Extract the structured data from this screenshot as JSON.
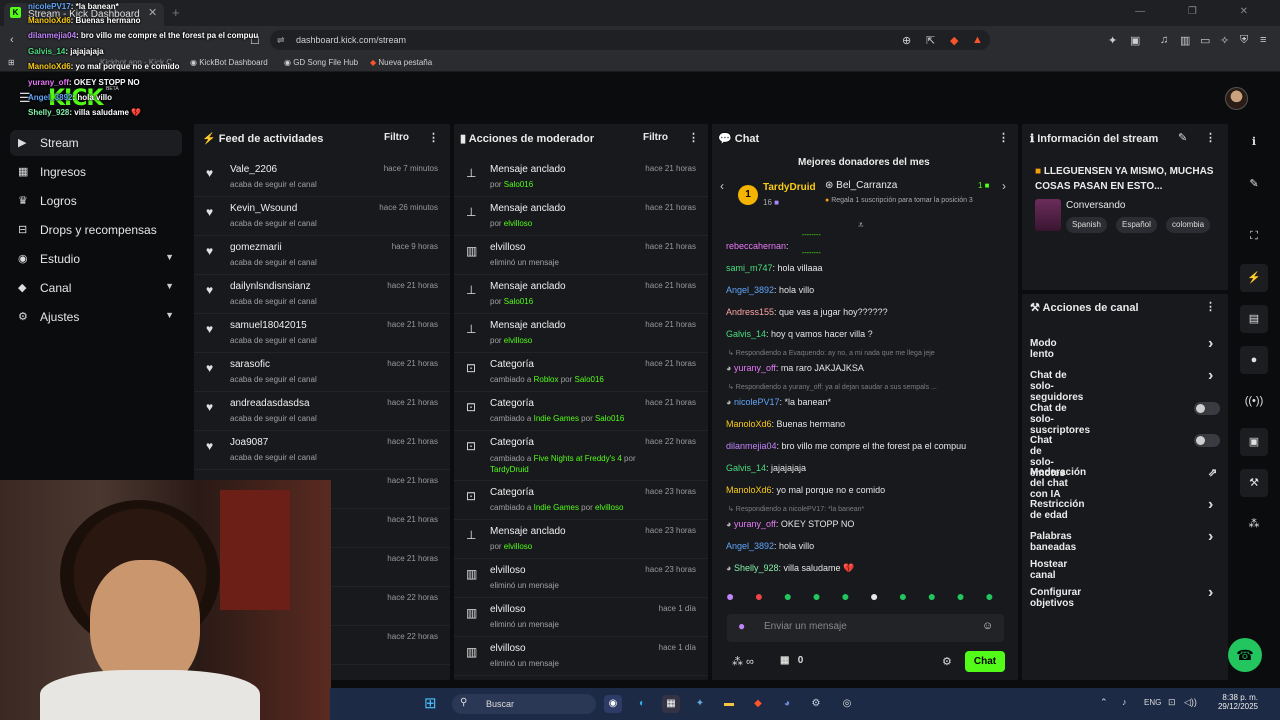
{
  "browser": {
    "tab_title": "Stream - Kick Dashboard",
    "url": "dashboard.kick.com/stream",
    "bookmarks": [
      "KickBot Dashboard",
      "GD Song File Hub",
      "Nueva pestaña"
    ],
    "bookmark_partial": "Kickbot app - Kick C..."
  },
  "header": {
    "logo": "KICK",
    "beta": "BETA"
  },
  "sidebar": {
    "items": [
      {
        "label": "Stream",
        "icon": "broadcast-icon",
        "active": true
      },
      {
        "label": "Ingresos",
        "icon": "money-icon"
      },
      {
        "label": "Logros",
        "icon": "trophy-icon"
      },
      {
        "label": "Drops y recompensas",
        "icon": "gift-icon"
      },
      {
        "label": "Estudio",
        "icon": "studio-icon",
        "expandable": true
      },
      {
        "label": "Canal",
        "icon": "channel-icon",
        "expandable": true
      },
      {
        "label": "Ajustes",
        "icon": "gear-icon",
        "expandable": true
      }
    ]
  },
  "activity_feed": {
    "title": "Feed de actividades",
    "filter": "Filtro",
    "items": [
      {
        "name": "Vale_2206",
        "action": "acaba de seguir el canal",
        "time": "hace 7 minutos"
      },
      {
        "name": "Kevin_Wsound",
        "action": "acaba de seguir el canal",
        "time": "hace 26 minutos"
      },
      {
        "name": "gomezmarii",
        "action": "acaba de seguir el canal",
        "time": "hace 9 horas"
      },
      {
        "name": "dailynlsndisnsianz",
        "action": "acaba de seguir el canal",
        "time": "hace 21 horas"
      },
      {
        "name": "samuel18042015",
        "action": "acaba de seguir el canal",
        "time": "hace 21 horas"
      },
      {
        "name": "sarasofic",
        "action": "acaba de seguir el canal",
        "time": "hace 21 horas"
      },
      {
        "name": "andreadasdasdsa",
        "action": "acaba de seguir el canal",
        "time": "hace 21 horas"
      },
      {
        "name": "Joa9087",
        "action": "acaba de seguir el canal",
        "time": "hace 21 horas"
      },
      {
        "name": "",
        "action": "",
        "time": "hace 21 horas"
      },
      {
        "name": "",
        "action": "",
        "time": "hace 21 horas"
      },
      {
        "name": "",
        "action": "",
        "time": "hace 21 horas"
      },
      {
        "name": "",
        "action": "",
        "time": "hace 22 horas"
      },
      {
        "name": "",
        "action": "",
        "time": "hace 22 horas"
      }
    ]
  },
  "mod_actions": {
    "title": "Acciones de moderador",
    "filter": "Filtro",
    "items": [
      {
        "icon": "pin-icon",
        "title": "Mensaje anclado",
        "pre": "por ",
        "user": "Salo016",
        "time": "hace 21 horas"
      },
      {
        "icon": "pin-icon",
        "title": "Mensaje anclado",
        "pre": "por ",
        "user": "elvilloso",
        "time": "hace 21 horas"
      },
      {
        "icon": "trash-icon",
        "title": "elvilloso",
        "pre": "eliminó un mensaje",
        "user": "",
        "time": "hace 21 horas"
      },
      {
        "icon": "pin-icon",
        "title": "Mensaje anclado",
        "pre": "por ",
        "user": "Salo016",
        "time": "hace 21 horas"
      },
      {
        "icon": "pin-icon",
        "title": "Mensaje anclado",
        "pre": "por ",
        "user": "elvilloso",
        "time": "hace 21 horas"
      },
      {
        "icon": "category-icon",
        "title": "Categoría",
        "pre": "cambiado a ",
        "cat": "Roblox",
        "mid": " por ",
        "user": "Salo016",
        "time": "hace 21 horas"
      },
      {
        "icon": "category-icon",
        "title": "Categoría",
        "pre": "cambiado a ",
        "cat": "Indie Games",
        "mid": " por ",
        "user": "Salo016",
        "time": "hace 21 horas"
      },
      {
        "icon": "category-icon",
        "title": "Categoría",
        "pre": "cambiado a ",
        "cat": "Five Nights at Freddy's 4",
        "mid": " por",
        "user": "TardyDruid",
        "time": "hace 22 horas",
        "two_line": true
      },
      {
        "icon": "category-icon",
        "title": "Categoría",
        "pre": "cambiado a ",
        "cat": "Indie Games",
        "mid": " por ",
        "user": "elvilloso",
        "time": "hace 23 horas"
      },
      {
        "icon": "pin-icon",
        "title": "Mensaje anclado",
        "pre": "por ",
        "user": "elvilloso",
        "time": "hace 23 horas"
      },
      {
        "icon": "trash-icon",
        "title": "elvilloso",
        "pre": "eliminó un mensaje",
        "user": "",
        "time": "hace 23 horas"
      },
      {
        "icon": "trash-icon",
        "title": "elvilloso",
        "pre": "eliminó un mensaje",
        "user": "",
        "time": "hace 1 día"
      },
      {
        "icon": "trash-icon",
        "title": "elvilloso",
        "pre": "eliminó un mensaje",
        "user": "",
        "time": "hace 1 día"
      }
    ]
  },
  "chat": {
    "title": "Chat",
    "top_title": "Mejores donadores del mes",
    "top1": {
      "rank": "1",
      "name": "TardyDruid",
      "count": "16"
    },
    "top2": {
      "name": "Bel_Carranza",
      "note": "Regala 1 suscripción para tomar la posición 3",
      "count": "1"
    },
    "messages": [
      {
        "user": "rebeccahernan",
        "color": "#e879f9",
        "text": ""
      },
      {
        "user": "sami_m747",
        "color": "#4ade80",
        "text": "hola villaaa"
      },
      {
        "user": "Angel_3892",
        "color": "#60a5fa",
        "text": "hola villo"
      },
      {
        "user": "Andress155",
        "color": "#fca5a5",
        "text": "que vas a jugar hoy??????"
      },
      {
        "user": "Galvis_14",
        "color": "#4ade80",
        "text": "hoy q vamos hacer villa ?"
      },
      {
        "reply": "Respondiendo a Evaquendo: ay no, a mi nada que me llega jeje"
      },
      {
        "user": "yurany_off",
        "color": "#e879f9",
        "text": "ma raro JAKJAJKSA",
        "badge": true
      },
      {
        "reply": "Respondiendo a yurany_off: ya al dejan saudar a sus sempals ..."
      },
      {
        "user": "nicolePV17",
        "color": "#60a5fa",
        "text": "*la banean*",
        "badge": true
      },
      {
        "user": "ManoloXd6",
        "color": "#facc15",
        "text": "Buenas hermano"
      },
      {
        "user": "dilanmejia04",
        "color": "#c084fc",
        "text": "bro villo me compre el the forest pa el compuu"
      },
      {
        "user": "Galvis_14",
        "color": "#4ade80",
        "text": "jajajajaja"
      },
      {
        "user": "ManoloXd6",
        "color": "#facc15",
        "text": "yo mal porque no e comido"
      },
      {
        "reply": "Respondiendo a nicolePV17: *la banean*"
      },
      {
        "user": "yurany_off",
        "color": "#e879f9",
        "text": "OKEY STOPP NO",
        "badge": true
      },
      {
        "user": "Angel_3892",
        "color": "#60a5fa",
        "text": "hola villo"
      },
      {
        "user": "Shelly_928",
        "color": "#86efac",
        "text": "villa saludame 💔",
        "badge": true
      }
    ],
    "input_placeholder": "Enviar un mensaje",
    "points": "0",
    "send": "Chat"
  },
  "stream_info": {
    "title": "Información del stream",
    "stream_title": "LLEGUENSEN YA MISMO, MUCHAS COSAS PASAN EN ESTO...",
    "category": "Conversando",
    "tags": [
      "Spanish",
      "Español",
      "colombia"
    ]
  },
  "channel_actions": {
    "title": "Acciones de canal",
    "items": [
      {
        "label": "Modo lento",
        "type": "chevron"
      },
      {
        "label": "Chat de solo-seguidores",
        "type": "chevron"
      },
      {
        "label": "Chat de solo-suscriptores",
        "type": "toggle"
      },
      {
        "label": "Chat de solo-emotes",
        "type": "toggle"
      },
      {
        "label": "Moderación del chat con IA",
        "type": "external"
      },
      {
        "label": "Restricción de edad",
        "type": "chevron"
      },
      {
        "label": "Palabras baneadas",
        "type": "chevron"
      },
      {
        "label": "Hostear canal",
        "type": "none"
      },
      {
        "label": "Configurar objetivos",
        "type": "chevron"
      }
    ]
  },
  "overlay_chat": [
    {
      "user": "nicolePV17",
      "color": "#60a5fa",
      "text": ": *la banean*"
    },
    {
      "user": "ManoloXd6",
      "color": "#facc15",
      "text": ": Buenas hermano"
    },
    {
      "user": "dilanmejia04",
      "color": "#c084fc",
      "text": ": bro villo me compre el the forest pa el compuu"
    },
    {
      "user": "Galvis_14",
      "color": "#4ade80",
      "text": ": jajajajaja"
    },
    {
      "user": "ManoloXd6",
      "color": "#facc15",
      "text": ": yo mal porque no e comido"
    },
    {
      "user": "yurany_off",
      "color": "#e879f9",
      "text": ": OKEY STOPP NO"
    },
    {
      "user": "Angel_3892",
      "color": "#60a5fa",
      "text": ": hola villo"
    },
    {
      "user": "Shelly_928",
      "color": "#86efac",
      "text": ": villa saludame 💔"
    }
  ],
  "taskbar": {
    "search": "Buscar",
    "lang": "ENG",
    "time": "8:38 p. m.",
    "date": "29/12/2025"
  },
  "colors": {
    "accent": "#53fc18",
    "bg": "#0b0c0e",
    "panel": "#18191c"
  }
}
